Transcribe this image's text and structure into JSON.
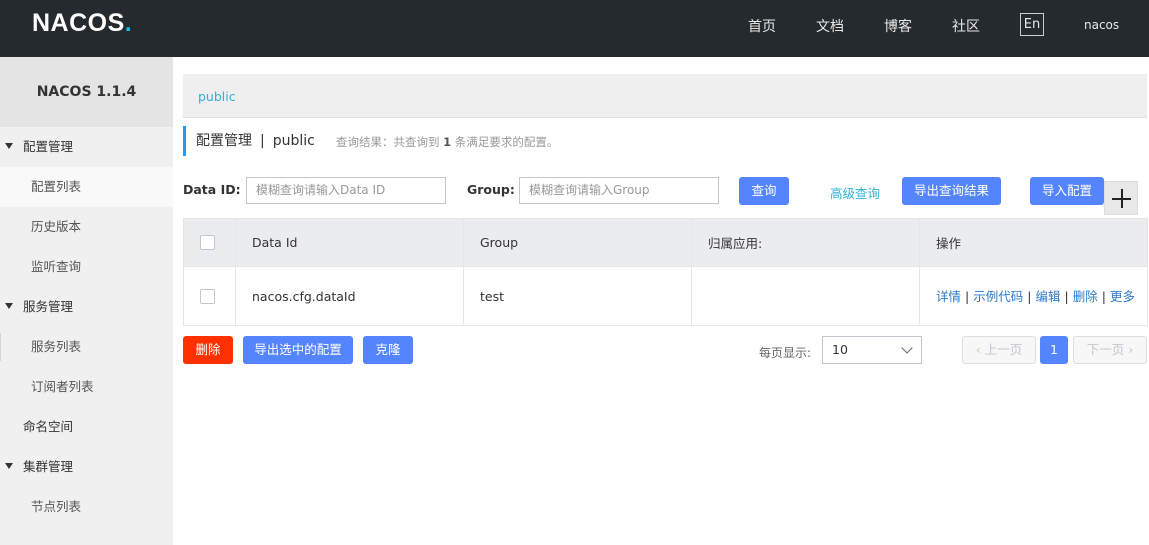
{
  "header": {
    "logo": "NACOS",
    "logo_dot": ".",
    "nav": [
      "首页",
      "文档",
      "博客",
      "社区"
    ],
    "lang": "En",
    "user": "nacos"
  },
  "sidebar": {
    "title": "NACOS 1.1.4",
    "groups": [
      {
        "label": "配置管理",
        "items": [
          "配置列表",
          "历史版本",
          "监听查询"
        ]
      },
      {
        "label": "服务管理",
        "items": [
          "服务列表",
          "订阅者列表"
        ]
      },
      {
        "label": "命名空间"
      },
      {
        "label": "集群管理",
        "items": [
          "节点列表"
        ]
      }
    ]
  },
  "namespace": {
    "current": "public"
  },
  "page": {
    "title": "配置管理",
    "separator": "|",
    "namespace": "public",
    "result_prefix": "查询结果：共查询到",
    "result_count": "1",
    "result_suffix": "条满足要求的配置。"
  },
  "search": {
    "data_id_label": "Data ID:",
    "data_id_placeholder": "模糊查询请输入Data ID",
    "group_label": "Group:",
    "group_placeholder": "模糊查询请输入Group",
    "query_button": "查询",
    "advanced_link": "高级查询",
    "export_button": "导出查询结果",
    "import_button": "导入配置"
  },
  "table": {
    "columns": [
      "Data Id",
      "Group",
      "归属应用:",
      "操作"
    ],
    "rows": [
      {
        "data_id": "nacos.cfg.dataId",
        "group": "test",
        "app": "",
        "ops": [
          "详情",
          "示例代码",
          "编辑",
          "删除",
          "更多"
        ]
      }
    ]
  },
  "footer": {
    "delete_button": "删除",
    "export_selected_button": "导出选中的配置",
    "clone_button": "克隆",
    "page_size_label": "每页显示:",
    "page_size": "10",
    "prev": "上一页",
    "current_page": "1",
    "next": "下一页"
  },
  "colors": {
    "topbar": "#252a2f",
    "primary": "#5584ff",
    "danger": "#ff3000",
    "link": "#2eb2d4"
  }
}
